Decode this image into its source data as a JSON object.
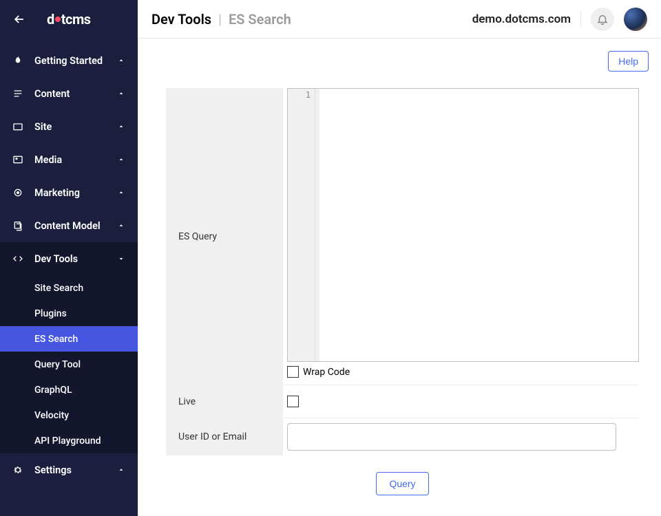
{
  "logo": {
    "pre": "d",
    "post": "tcms"
  },
  "breadcrumb": {
    "section": "Dev Tools",
    "page": "ES Search"
  },
  "domain": "demo.dotcms.com",
  "help_label": "Help",
  "sidebar": [
    {
      "label": "Getting Started",
      "icon": "flame"
    },
    {
      "label": "Content",
      "icon": "lines"
    },
    {
      "label": "Site",
      "icon": "folder"
    },
    {
      "label": "Media",
      "icon": "gallery"
    },
    {
      "label": "Marketing",
      "icon": "target"
    },
    {
      "label": "Content Model",
      "icon": "stack"
    }
  ],
  "devtools": {
    "label": "Dev Tools",
    "items": [
      "Site Search",
      "Plugins",
      "ES Search",
      "Query Tool",
      "GraphQL",
      "Velocity",
      "API Playground"
    ],
    "active_index": 2
  },
  "settings_label": "Settings",
  "form": {
    "es_query_label": "ES Query",
    "gutter_line": "1",
    "wrap_code_label": "Wrap Code",
    "wrap_code_checked": false,
    "live_label": "Live",
    "live_checked": false,
    "user_label": "User ID or Email",
    "user_value": "",
    "query_button": "Query"
  }
}
